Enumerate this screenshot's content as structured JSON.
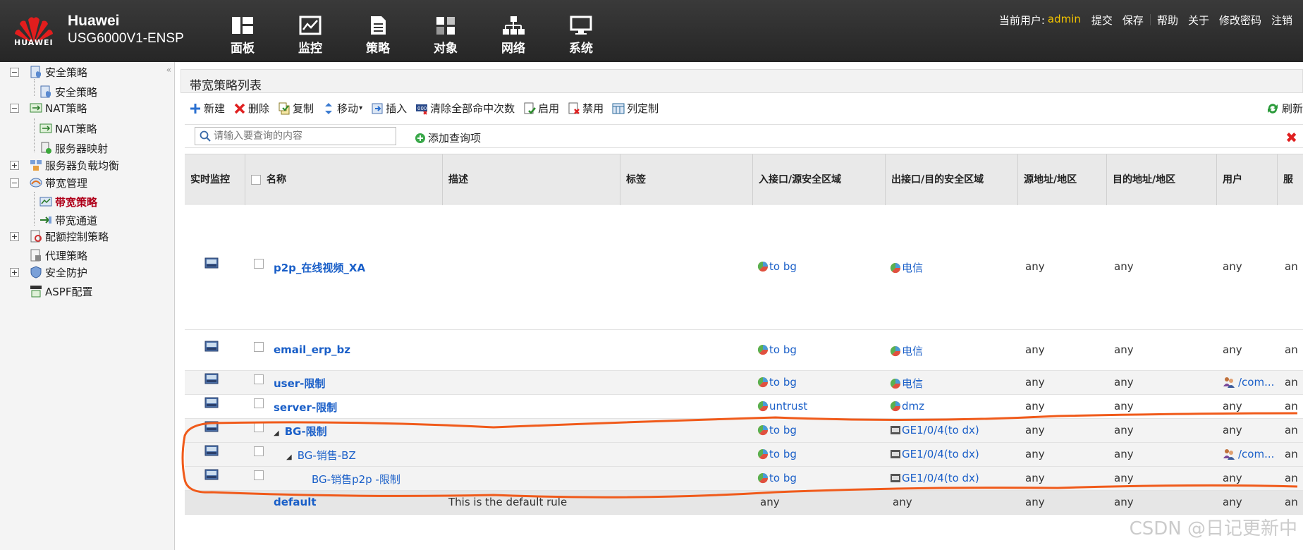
{
  "header": {
    "brand": "Huawei",
    "model": "USG6000V1-ENSP",
    "logo_text": "HUAWEI",
    "nav": [
      {
        "label": "面板",
        "icon": "dashboard-icon"
      },
      {
        "label": "监控",
        "icon": "monitor-icon"
      },
      {
        "label": "策略",
        "icon": "policy-icon"
      },
      {
        "label": "对象",
        "icon": "object-icon"
      },
      {
        "label": "网络",
        "icon": "network-icon"
      },
      {
        "label": "系统",
        "icon": "system-icon"
      }
    ],
    "user_label": "当前用户:",
    "user_name": "admin",
    "links": [
      "提交",
      "保存",
      "帮助",
      "关于",
      "修改密码",
      "注销"
    ]
  },
  "sidebar": {
    "items": [
      {
        "label": "安全策略"
      },
      {
        "label": "安全策略"
      },
      {
        "label": "NAT策略"
      },
      {
        "label": "NAT策略"
      },
      {
        "label": "服务器映射"
      },
      {
        "label": "服务器负载均衡"
      },
      {
        "label": "带宽管理"
      },
      {
        "label": "带宽策略"
      },
      {
        "label": "带宽通道"
      },
      {
        "label": "配额控制策略"
      },
      {
        "label": "代理策略"
      },
      {
        "label": "安全防护"
      },
      {
        "label": "ASPF配置"
      }
    ]
  },
  "main": {
    "title": "带宽策略列表",
    "toolbar": [
      "新建",
      "删除",
      "复制",
      "移动",
      "插入",
      "清除全部命中次数",
      "启用",
      "禁用",
      "列定制"
    ],
    "refresh": "刷新",
    "search_placeholder": "请输入要查询的内容",
    "add_query": "添加查询项",
    "columns": [
      "实时监控",
      "名称",
      "描述",
      "标签",
      "入接口/源安全区域",
      "出接口/目的安全区域",
      "源地址/地区",
      "目的地址/地区",
      "用户",
      "服"
    ],
    "rows": [
      {
        "name": "p2p_在线视频_XA",
        "desc": "",
        "in": "to bg",
        "out": "电信",
        "src": "any",
        "dst": "any",
        "user": "any",
        "svc": "an"
      },
      {
        "name": "email_erp_bz",
        "desc": "",
        "in": "to bg",
        "out": "电信",
        "src": "any",
        "dst": "any",
        "user": "any",
        "svc": "an"
      },
      {
        "name": "user-限制",
        "desc": "",
        "in": "to bg",
        "out": "电信",
        "src": "any",
        "dst": "any",
        "user": "/com...",
        "svc": "an"
      },
      {
        "name": "server-限制",
        "desc": "",
        "in": "untrust",
        "out": "dmz",
        "src": "any",
        "dst": "any",
        "user": "any",
        "svc": "an"
      },
      {
        "name": "BG-限制",
        "desc": "",
        "in": "to bg",
        "out": "GE1/0/4(to dx)",
        "src": "any",
        "dst": "any",
        "user": "any",
        "svc": "an"
      },
      {
        "name": "BG-销售-BZ",
        "desc": "",
        "in": "to bg",
        "out": "GE1/0/4(to dx)",
        "src": "any",
        "dst": "any",
        "user": "/com...",
        "svc": "an"
      },
      {
        "name": "BG-销售p2p -限制",
        "desc": "",
        "in": "to bg",
        "out": "GE1/0/4(to dx)",
        "src": "any",
        "dst": "any",
        "user": "any",
        "svc": "an"
      },
      {
        "name": "default",
        "desc": "This is the default rule",
        "in": "any",
        "out": "any",
        "src": "any",
        "dst": "any",
        "user": "any",
        "svc": "an"
      }
    ]
  },
  "colors": {
    "accent_link": "#1a5fc8",
    "active_red": "#b0001a",
    "annotation": "#f05a1a",
    "user_yellow": "#f3c400"
  },
  "watermark": "CSDN @日记更新中"
}
